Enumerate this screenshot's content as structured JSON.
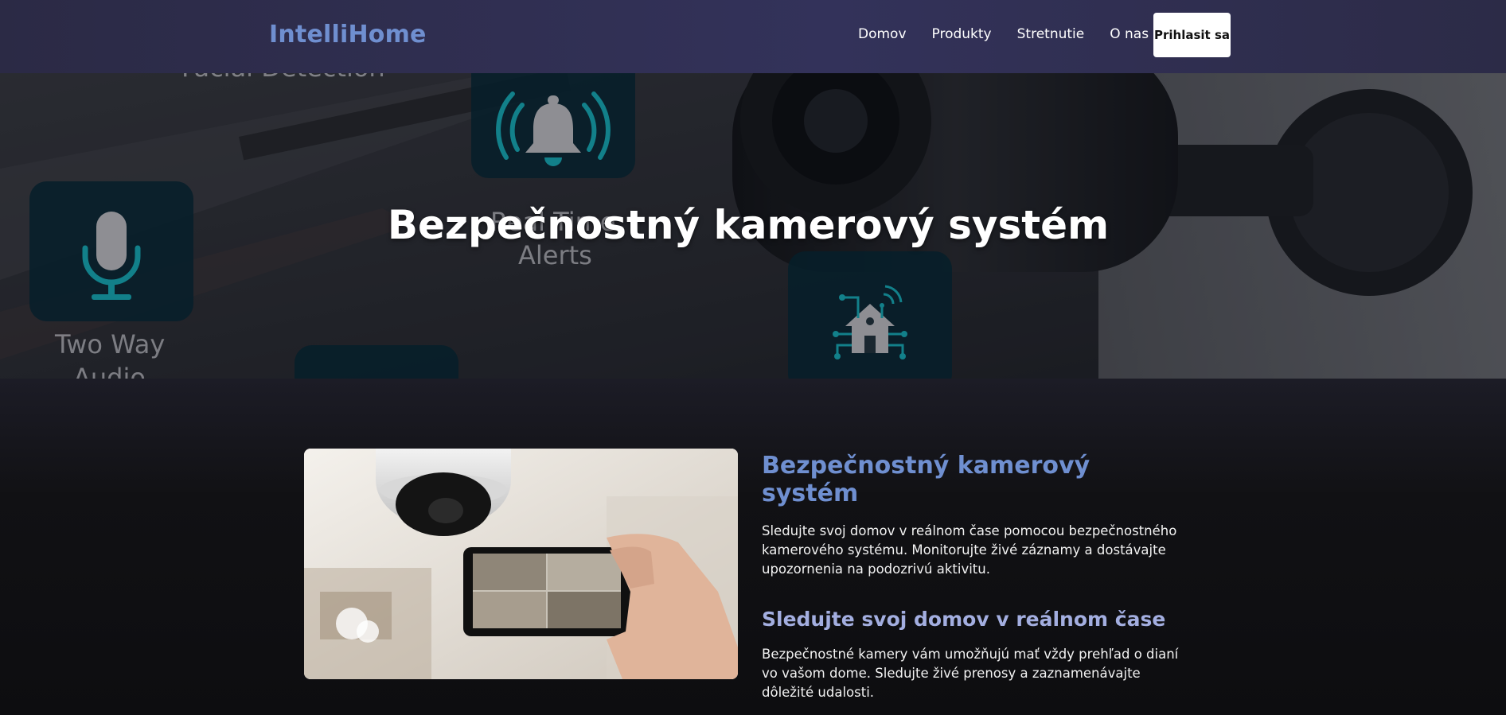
{
  "nav": {
    "logo": "IntelliHome",
    "links": [
      "Domov",
      "Produkty",
      "Stretnutie",
      "O nas"
    ],
    "login_label": "Prihlasit sa"
  },
  "hero": {
    "title": "Bezpečnostný kamerový systém",
    "feature_labels": {
      "top_partial": "Facial Detection",
      "alerts_line1": "Real Time",
      "alerts_line2": "Alerts",
      "audio_line1": "Two Way",
      "audio_line2": "Audio"
    }
  },
  "section": {
    "heading": "Bezpečnostný kamerový systém",
    "paragraph1": "Sledujte svoj domov v reálnom čase pomocou bezpečnostného kamerového systému. Monitorujte živé záznamy a dostávajte upozornenia na podozrivú aktivitu.",
    "subheading": "Sledujte svoj domov v reálnom čase",
    "paragraph2": "Bezpečnostné kamery vám umožňujú mať vždy prehľad o dianí vo vašom dome. Sledujte živé prenosy a zaznamenávajte dôležité udalosti."
  },
  "colors": {
    "accent": "#6f8fd0",
    "subheading": "#a3aee0",
    "icon_teal": "#12808a"
  },
  "icons": [
    "bell-icon",
    "microphone-icon",
    "smart-home-icon"
  ]
}
